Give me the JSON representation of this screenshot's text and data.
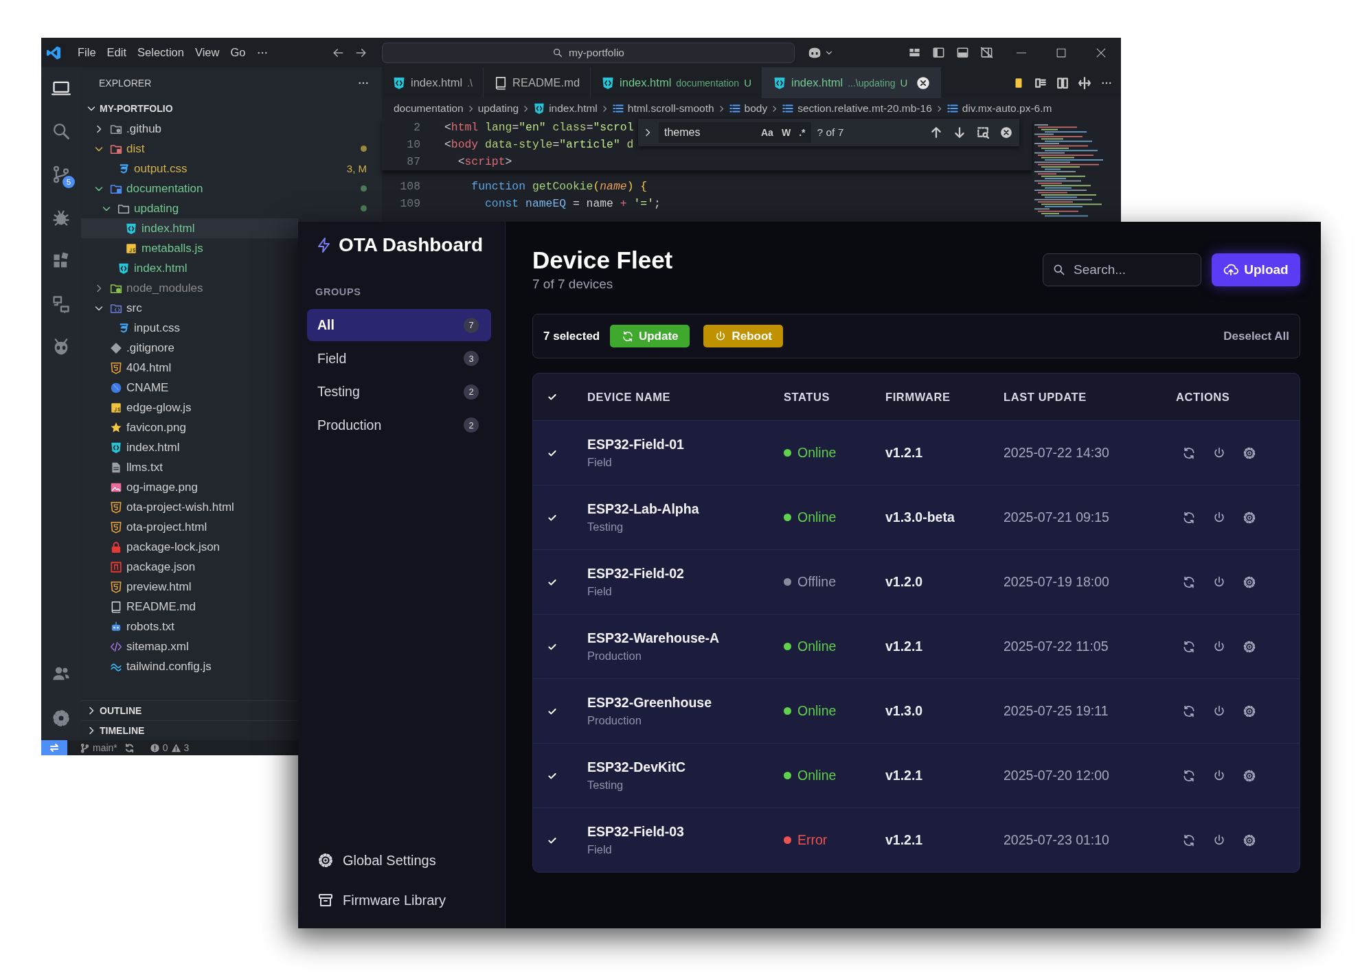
{
  "vscode": {
    "menu": [
      "File",
      "Edit",
      "Selection",
      "View",
      "Go"
    ],
    "command_center": "my-portfolio",
    "activity_bar": [
      {
        "kind": "explorer",
        "selected": true
      },
      {
        "kind": "search",
        "selected": false
      },
      {
        "kind": "source-control",
        "selected": false,
        "badge": "5"
      },
      {
        "kind": "debug",
        "selected": false
      },
      {
        "kind": "extensions",
        "selected": false
      },
      {
        "kind": "remote",
        "selected": false
      },
      {
        "kind": "alien",
        "selected": false
      }
    ],
    "activity_bar_bottom": [
      {
        "kind": "accounts"
      },
      {
        "kind": "settings"
      }
    ],
    "explorer": {
      "title": "EXPLORER",
      "root": {
        "label": "MY-PORTFOLIO",
        "expanded": true
      },
      "items": [
        {
          "label": ".github",
          "kind": "folder-github",
          "expanded": false,
          "selected": false
        },
        {
          "label": "dist",
          "kind": "folder-dist",
          "expanded": true,
          "selected": false,
          "modified": true,
          "color": "#9a8840",
          "children": [
            {
              "label": "output.css",
              "kind": "css",
              "selected": false,
              "modified": true,
              "decoration": "3, M"
            }
          ]
        },
        {
          "label": "documentation",
          "kind": "folder-docs",
          "expanded": true,
          "selected": false,
          "untracked": true,
          "color": "#4c7a57",
          "children": [
            {
              "label": "updating",
              "kind": "folder",
              "expanded": true,
              "selected": false,
              "untracked": true,
              "color": "#4c7a57",
              "children": [
                {
                  "label": "index.html",
                  "kind": "html",
                  "selected": true,
                  "untracked": true
                },
                {
                  "label": "metaballs.js",
                  "kind": "js",
                  "selected": false,
                  "untracked": true
                }
              ]
            },
            {
              "label": "index.html",
              "kind": "html",
              "selected": false,
              "untracked": true
            }
          ]
        },
        {
          "label": "node_modules",
          "kind": "folder-node",
          "expanded": false,
          "selected": false,
          "ignored": true
        },
        {
          "label": "src",
          "kind": "folder-src",
          "expanded": true,
          "selected": false,
          "children": [
            {
              "label": "input.css",
              "kind": "css",
              "selected": false
            }
          ]
        },
        {
          "label": ".gitignore",
          "kind": "git",
          "selected": false
        },
        {
          "label": "404.html",
          "kind": "html5",
          "selected": false
        },
        {
          "label": "CNAME",
          "kind": "globe",
          "selected": false
        },
        {
          "label": "edge-glow.js",
          "kind": "js",
          "selected": false
        },
        {
          "label": "favicon.png",
          "kind": "star",
          "selected": false
        },
        {
          "label": "index.html",
          "kind": "html",
          "selected": false
        },
        {
          "label": "llms.txt",
          "kind": "text",
          "selected": false
        },
        {
          "label": "og-image.png",
          "kind": "image",
          "selected": false
        },
        {
          "label": "ota-project-wish.html",
          "kind": "html5",
          "selected": false
        },
        {
          "label": "ota-project.html",
          "kind": "html5",
          "selected": false
        },
        {
          "label": "package-lock.json",
          "kind": "lock",
          "selected": false
        },
        {
          "label": "package.json",
          "kind": "npm",
          "selected": false
        },
        {
          "label": "preview.html",
          "kind": "html5",
          "selected": false
        },
        {
          "label": "README.md",
          "kind": "readme",
          "selected": false
        },
        {
          "label": "robots.txt",
          "kind": "robot",
          "selected": false
        },
        {
          "label": "sitemap.xml",
          "kind": "xml",
          "selected": false
        },
        {
          "label": "tailwind.config.js",
          "kind": "tailwind",
          "selected": false
        }
      ],
      "panels": [
        {
          "label": "OUTLINE",
          "expanded": false
        },
        {
          "label": "TIMELINE",
          "expanded": false
        }
      ]
    },
    "tabs": [
      {
        "label": "index.html",
        "kind": "html",
        "description": ".\\",
        "selected": false
      },
      {
        "label": "README.md",
        "kind": "readme",
        "selected": false
      },
      {
        "label": "index.html",
        "kind": "html",
        "description": "documentation",
        "status": "U",
        "untracked": true,
        "selected": false
      },
      {
        "label": "index.html",
        "kind": "html",
        "description": "...\\updating",
        "status": "U",
        "untracked": true,
        "selected": true
      }
    ],
    "breadcrumb": [
      {
        "label": "documentation",
        "kind": "folder"
      },
      {
        "label": "updating",
        "kind": "folder"
      },
      {
        "label": "index.html",
        "kind": "html"
      },
      {
        "label": "html.scroll-smooth",
        "kind": "symbol"
      },
      {
        "label": "body",
        "kind": "symbol"
      },
      {
        "label": "section.relative.mt-20.mb-16",
        "kind": "symbol"
      },
      {
        "label": "div.mx-auto.px-6.m",
        "kind": "symbol"
      }
    ],
    "sticky_lines": [
      {
        "number": "2",
        "tokens": [
          {
            "text": "<",
            "kind": "punct"
          },
          {
            "text": "html",
            "kind": "tag"
          },
          {
            "text": " lang",
            "kind": "attr"
          },
          {
            "text": "=",
            "kind": "punct"
          },
          {
            "text": "\"en\"",
            "kind": "string"
          },
          {
            "text": " class",
            "kind": "attr"
          },
          {
            "text": "=",
            "kind": "punct"
          },
          {
            "text": "\"scrol",
            "kind": "string"
          }
        ]
      },
      {
        "number": "10",
        "tokens": [
          {
            "text": "<",
            "kind": "punct"
          },
          {
            "text": "body",
            "kind": "tag"
          },
          {
            "text": " data-style",
            "kind": "attr"
          },
          {
            "text": "=",
            "kind": "punct"
          },
          {
            "text": "\"article\"",
            "kind": "string"
          },
          {
            "text": " d",
            "kind": "attr"
          }
        ]
      },
      {
        "number": "87",
        "tokens": [
          {
            "text": "  <",
            "kind": "punct"
          },
          {
            "text": "script",
            "kind": "tag"
          },
          {
            "text": ">",
            "kind": "punct"
          }
        ]
      }
    ],
    "lines": [
      {
        "number": "108",
        "tokens": [
          {
            "text": "    function",
            "kind": "keyword"
          },
          {
            "text": " getCookie",
            "kind": "func"
          },
          {
            "text": "(",
            "kind": "bracket"
          },
          {
            "text": "name",
            "kind": "param"
          },
          {
            "text": ") {",
            "kind": "bracket"
          }
        ]
      },
      {
        "number": "109",
        "tokens": [
          {
            "text": "      const",
            "kind": "keyword"
          },
          {
            "text": " nameEQ",
            "kind": "var"
          },
          {
            "text": " = ",
            "kind": "punct"
          },
          {
            "text": "name",
            "kind": "plain"
          },
          {
            "text": " + ",
            "kind": "op"
          },
          {
            "text": "'='",
            "kind": "string"
          },
          {
            "text": ";",
            "kind": "punct"
          }
        ]
      }
    ],
    "find": {
      "value": "themes",
      "options": [
        {
          "label": "Aa",
          "selected": false
        },
        {
          "label": "W",
          "selected": false
        },
        {
          "label": ".*",
          "selected": false
        }
      ],
      "count": "? of 7"
    },
    "status_bar": {
      "branch": "main*",
      "errors": "0",
      "warnings": "3"
    }
  },
  "ota": {
    "brand": "OTA Dashboard",
    "groups_heading": "GROUPS",
    "groups": [
      {
        "label": "All",
        "count": "7",
        "selected": true
      },
      {
        "label": "Field",
        "count": "3",
        "selected": false
      },
      {
        "label": "Testing",
        "count": "2",
        "selected": false
      },
      {
        "label": "Production",
        "count": "2",
        "selected": false
      }
    ],
    "footer_links": [
      {
        "label": "Global Settings",
        "kind": "settings"
      },
      {
        "label": "Firmware Library",
        "kind": "library"
      }
    ],
    "title": "Device Fleet",
    "subtitle": "7 of 7 devices",
    "search": {
      "placeholder": "Search..."
    },
    "upload_button": "Upload",
    "bulk_bar": {
      "selected_text": "7 selected",
      "actions": [
        {
          "label": "Update",
          "kind": "update"
        },
        {
          "label": "Reboot",
          "kind": "reboot"
        }
      ],
      "deselect": "Deselect All"
    },
    "table": {
      "all_checked": true,
      "columns": [
        "DEVICE NAME",
        "STATUS",
        "FIRMWARE",
        "LAST UPDATE",
        "ACTIONS"
      ],
      "rows": [
        {
          "checked": true,
          "name": "ESP32-Field-01",
          "group": "Field",
          "kind": "online",
          "status_label": "Online",
          "firmware": "v1.2.1",
          "last_update": "2025-07-22 14:30"
        },
        {
          "checked": true,
          "name": "ESP32-Lab-Alpha",
          "group": "Testing",
          "kind": "online",
          "status_label": "Online",
          "firmware": "v1.3.0-beta",
          "last_update": "2025-07-21 09:15"
        },
        {
          "checked": true,
          "name": "ESP32-Field-02",
          "group": "Field",
          "kind": "offline",
          "status_label": "Offline",
          "firmware": "v1.2.0",
          "last_update": "2025-07-19 18:00"
        },
        {
          "checked": true,
          "name": "ESP32-Warehouse-A",
          "group": "Production",
          "kind": "online",
          "status_label": "Online",
          "firmware": "v1.2.1",
          "last_update": "2025-07-22 11:05"
        },
        {
          "checked": true,
          "name": "ESP32-Greenhouse",
          "group": "Production",
          "kind": "online",
          "status_label": "Online",
          "firmware": "v1.3.0",
          "last_update": "2025-07-25 19:11"
        },
        {
          "checked": true,
          "name": "ESP32-DevKitC",
          "group": "Testing",
          "kind": "online",
          "status_label": "Online",
          "firmware": "v1.2.1",
          "last_update": "2025-07-20 12:00"
        },
        {
          "checked": true,
          "name": "ESP32-Field-03",
          "group": "Field",
          "kind": "error",
          "status_label": "Error",
          "firmware": "v1.2.1",
          "last_update": "2025-07-23 01:10"
        }
      ]
    }
  }
}
